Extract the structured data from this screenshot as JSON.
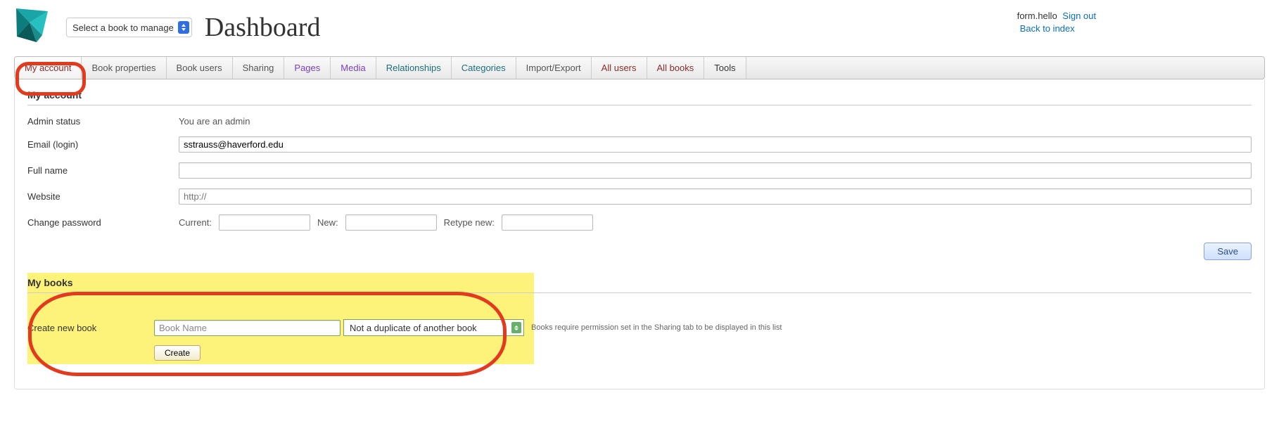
{
  "top": {
    "username": "form.hello",
    "signout": "Sign out",
    "back": "Back to index"
  },
  "header": {
    "book_select_value": "Select a book to manage",
    "page_title": "Dashboard"
  },
  "tabs": [
    {
      "label": "My account",
      "cls": "active maroon"
    },
    {
      "label": "Book properties",
      "cls": ""
    },
    {
      "label": "Book users",
      "cls": ""
    },
    {
      "label": "Sharing",
      "cls": ""
    },
    {
      "label": "Pages",
      "cls": "purple"
    },
    {
      "label": "Media",
      "cls": "purple"
    },
    {
      "label": "Relationships",
      "cls": "teal"
    },
    {
      "label": "Categories",
      "cls": "teal"
    },
    {
      "label": "Import/Export",
      "cls": ""
    },
    {
      "label": "All users",
      "cls": "maroon"
    },
    {
      "label": "All books",
      "cls": "maroon"
    },
    {
      "label": "Tools",
      "cls": "dark"
    }
  ],
  "account": {
    "section_title": "My account",
    "admin_status_label": "Admin status",
    "admin_status_value": "You are an admin",
    "email_label": "Email (login)",
    "email_value": "sstrauss@haverford.edu",
    "fullname_label": "Full name",
    "fullname_value": "",
    "website_label": "Website",
    "website_placeholder": "http://",
    "changepw_label": "Change password",
    "pw_current": "Current:",
    "pw_new": "New:",
    "pw_retype": "Retype new:",
    "save_label": "Save"
  },
  "books": {
    "section_title": "My books",
    "create_label": "Create new book",
    "bookname_value": "Book Name",
    "duplicate_value": "Not a duplicate of another book",
    "helper": "Books require permission set in the Sharing tab to be displayed in this list",
    "create_button": "Create"
  }
}
